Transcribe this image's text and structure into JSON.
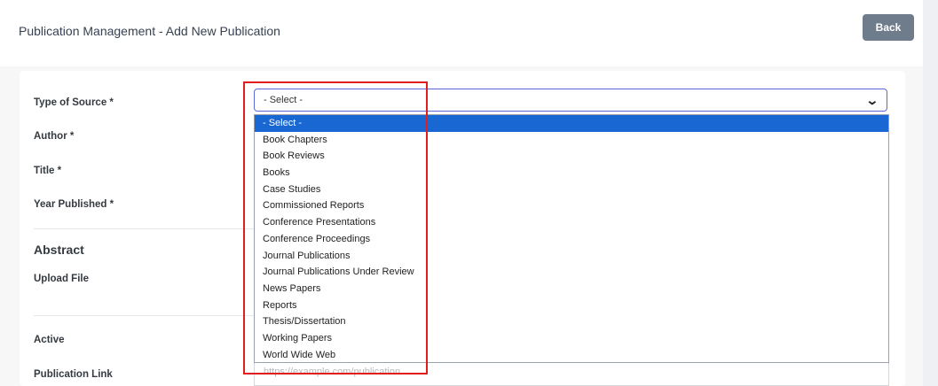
{
  "header": {
    "title": "Publication Management - Add New Publication",
    "back_label": "Back"
  },
  "form": {
    "type_of_source_label": "Type of Source *",
    "author_label": "Author *",
    "title_label": "Title *",
    "year_label": "Year Published *",
    "abstract_heading": "Abstract",
    "upload_label": "Upload File",
    "active_label": "Active",
    "publication_link_label": "Publication Link",
    "publication_link_placeholder": "https://example.com/publication"
  },
  "type_select": {
    "selected_value": "- Select -",
    "options": [
      "- Select -",
      "Book Chapters",
      "Book Reviews",
      "Books",
      "Case Studies",
      "Commissioned Reports",
      "Conference Presentations",
      "Conference Proceedings",
      "Journal Publications",
      "Journal Publications Under Review",
      "News Papers",
      "Reports",
      "Thesis/Dissertation",
      "Working Papers",
      "World Wide Web"
    ],
    "highlighted_index": 0
  },
  "icons": {
    "select_chevron": "chevron-down-icon"
  },
  "colors": {
    "accent": "#1967d2",
    "back_button": "#6f7c8c",
    "annotation": "#e11d1d"
  }
}
